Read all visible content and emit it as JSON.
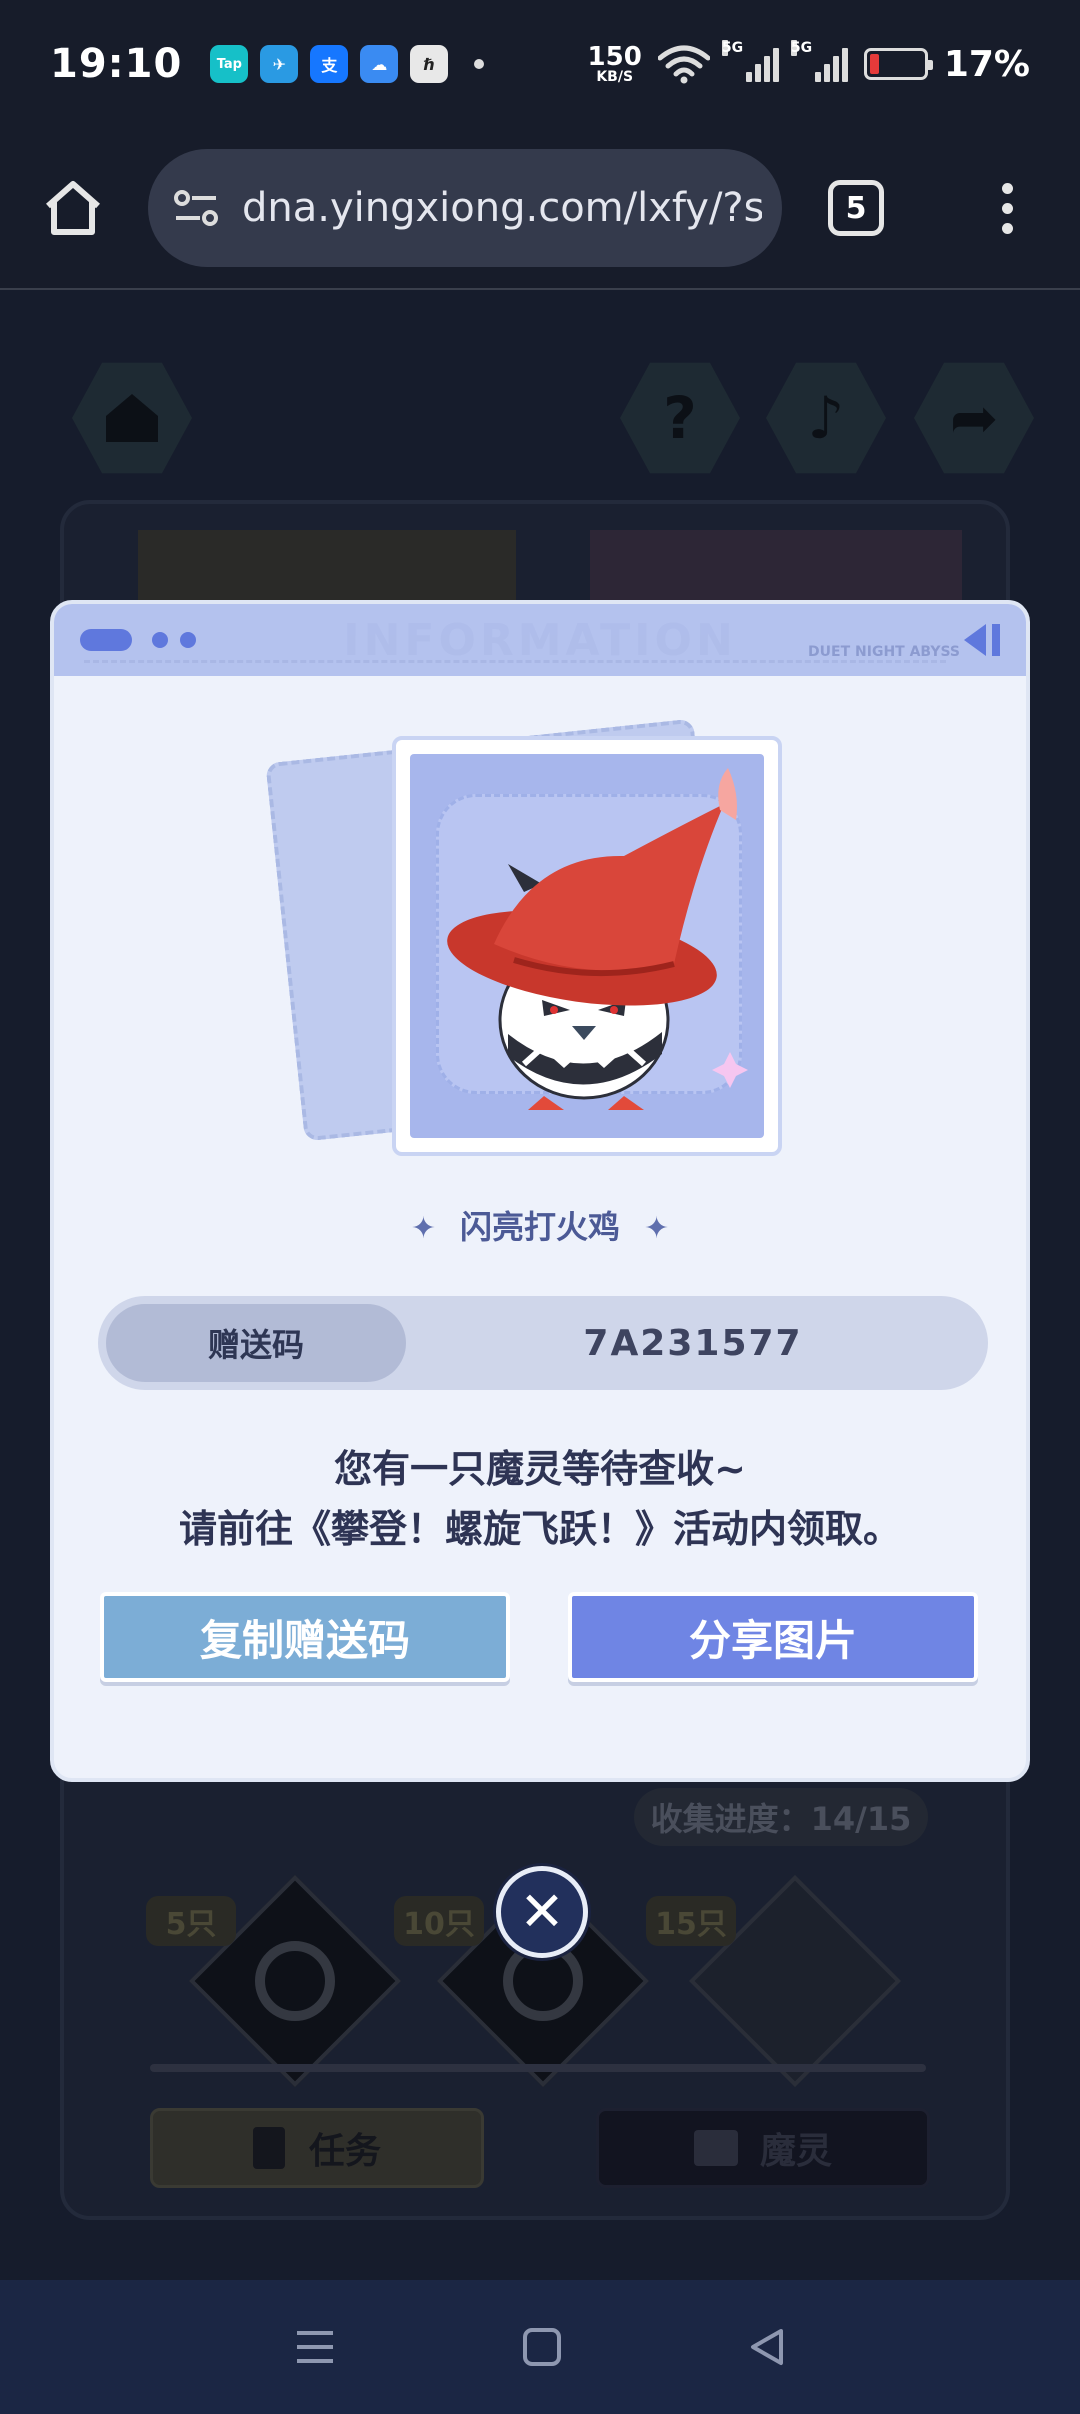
{
  "status_bar": {
    "time": "19:10",
    "apps": [
      {
        "name": "taptap-icon",
        "label": "Tap",
        "color": "#16c0c8"
      },
      {
        "name": "telegram-icon",
        "label": "✈",
        "color": "#2a9ae3"
      },
      {
        "name": "alipay-icon",
        "label": "支",
        "color": "#1677ff"
      },
      {
        "name": "weather-icon",
        "label": "☁",
        "color": "#3a8bf2"
      },
      {
        "name": "app-icon",
        "label": "ℏ",
        "color": "#e8e8e8"
      }
    ],
    "net_speed_value": "150",
    "net_speed_unit": "KB/S",
    "signal_label_1": "5G",
    "signal_label_2": "5G",
    "battery_percent": "17%",
    "battery_level": 0.17
  },
  "browser": {
    "url": "dna.yingxiong.com/lxfy/?s",
    "tab_count": "5"
  },
  "modal": {
    "pet_name": "闪亮打火鸡",
    "code_label": "赠送码",
    "code_value": "7A231577",
    "message_line1": "您有一只魔灵等待查收~",
    "message_line2": "请前往《攀登！螺旋飞跃！》活动内领取。",
    "copy_button": "复制赠送码",
    "share_button": "分享图片",
    "header_faint": "INFORMATION",
    "header_sub": "DUET NIGHT ABYSS"
  },
  "background": {
    "progress_text": "收集进度：14/15",
    "milestones": [
      "5只",
      "10只",
      "15只"
    ],
    "task_button": "任务",
    "spirit_button": "魔灵"
  }
}
